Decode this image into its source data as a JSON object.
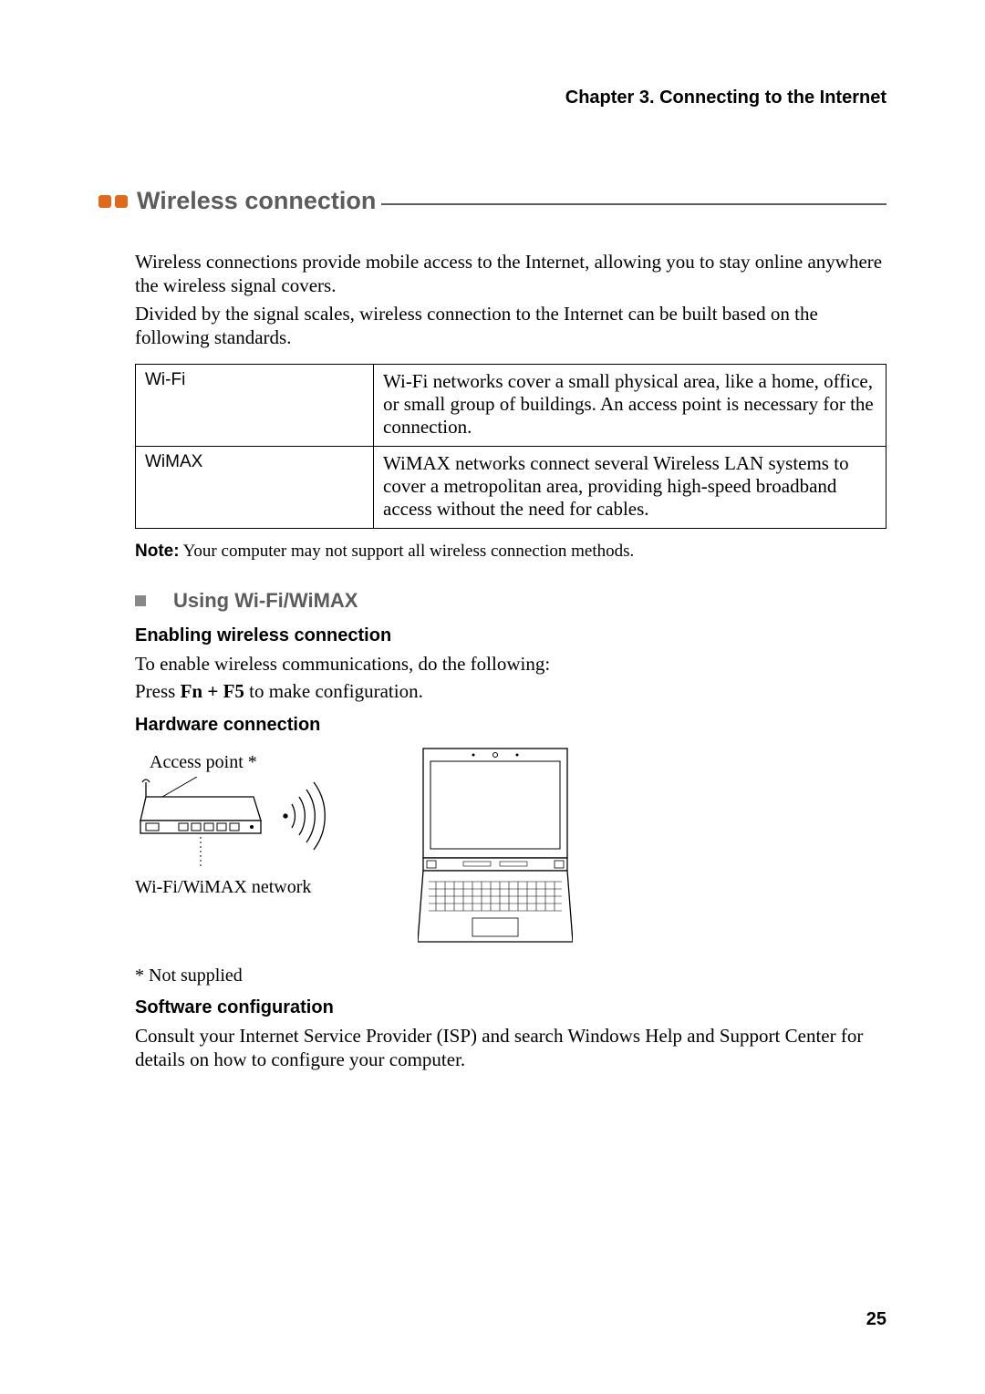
{
  "chapter_header": "Chapter 3. Connecting to the Internet",
  "section_title": "Wireless connection",
  "intro_p1": "Wireless connections provide mobile access to the Internet, allowing you to stay online anywhere the wireless signal covers.",
  "intro_p2": "Divided by the signal scales, wireless connection to the Internet can be built based on the following standards.",
  "table": {
    "row1": {
      "label": "Wi-Fi",
      "desc": "Wi-Fi networks cover a small physical area, like a home, office, or small group of buildings. An access point is necessary for the connection."
    },
    "row2": {
      "label": "WiMAX",
      "desc": "WiMAX networks connect several Wireless LAN systems to cover a metropolitan area, providing high-speed broadband access without the need for cables."
    }
  },
  "note_label": "Note:",
  "note_text": "Your computer may not support all wireless connection methods.",
  "subsection_title": "Using Wi-Fi/WiMAX",
  "h_enable": "Enabling wireless connection",
  "enable_p1": "To enable wireless communications, do the following:",
  "enable_p2a": "Press ",
  "enable_p2_bold": "Fn + F5",
  "enable_p2b": " to make configuration.",
  "h_hardware": "Hardware connection",
  "ap_label": "Access point *",
  "network_label": "Wi-Fi/WiMAX network",
  "footnote": "* Not supplied",
  "h_software": "Software configuration",
  "software_p": "Consult your Internet Service Provider (ISP) and search Windows Help and Support Center for details on how to configure your computer.",
  "page_number": "25"
}
